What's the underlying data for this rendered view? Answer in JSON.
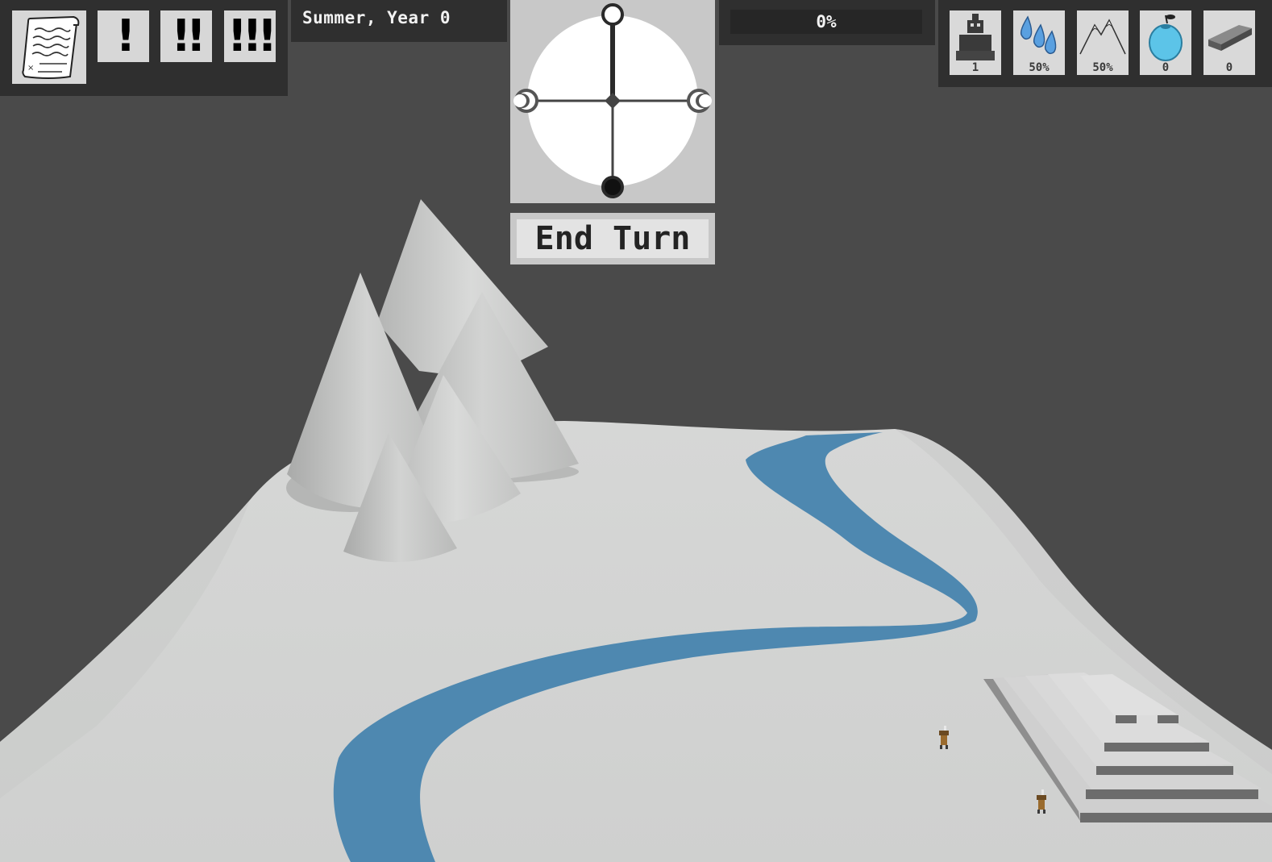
{
  "season_label": "Summer, Year 0",
  "progress": {
    "label": "0%",
    "fraction": 0.0
  },
  "end_turn_label": "End Turn",
  "alerts": [
    {
      "name": "alert-low-button",
      "label": "!"
    },
    {
      "name": "alert-medium-button",
      "label": "!!"
    },
    {
      "name": "alert-high-button",
      "label": "!!!"
    }
  ],
  "resources": [
    {
      "name": "population",
      "icon": "robot-icon",
      "value": "1"
    },
    {
      "name": "water",
      "icon": "water-drops-icon",
      "value": "50%"
    },
    {
      "name": "terrain",
      "icon": "mountain-icon",
      "value": "50%"
    },
    {
      "name": "food",
      "icon": "berry-icon",
      "value": "0"
    },
    {
      "name": "metal",
      "icon": "ingot-icon",
      "value": "0"
    }
  ],
  "colors": {
    "background": "#4a4a4a",
    "panel": "#2f2f2f",
    "tile": "#d7d7d7",
    "river": "#4e88b0",
    "terrain": "#d3d4d3",
    "water_icon": "#5aa0e0",
    "berry_icon": "#5cc4e8"
  }
}
